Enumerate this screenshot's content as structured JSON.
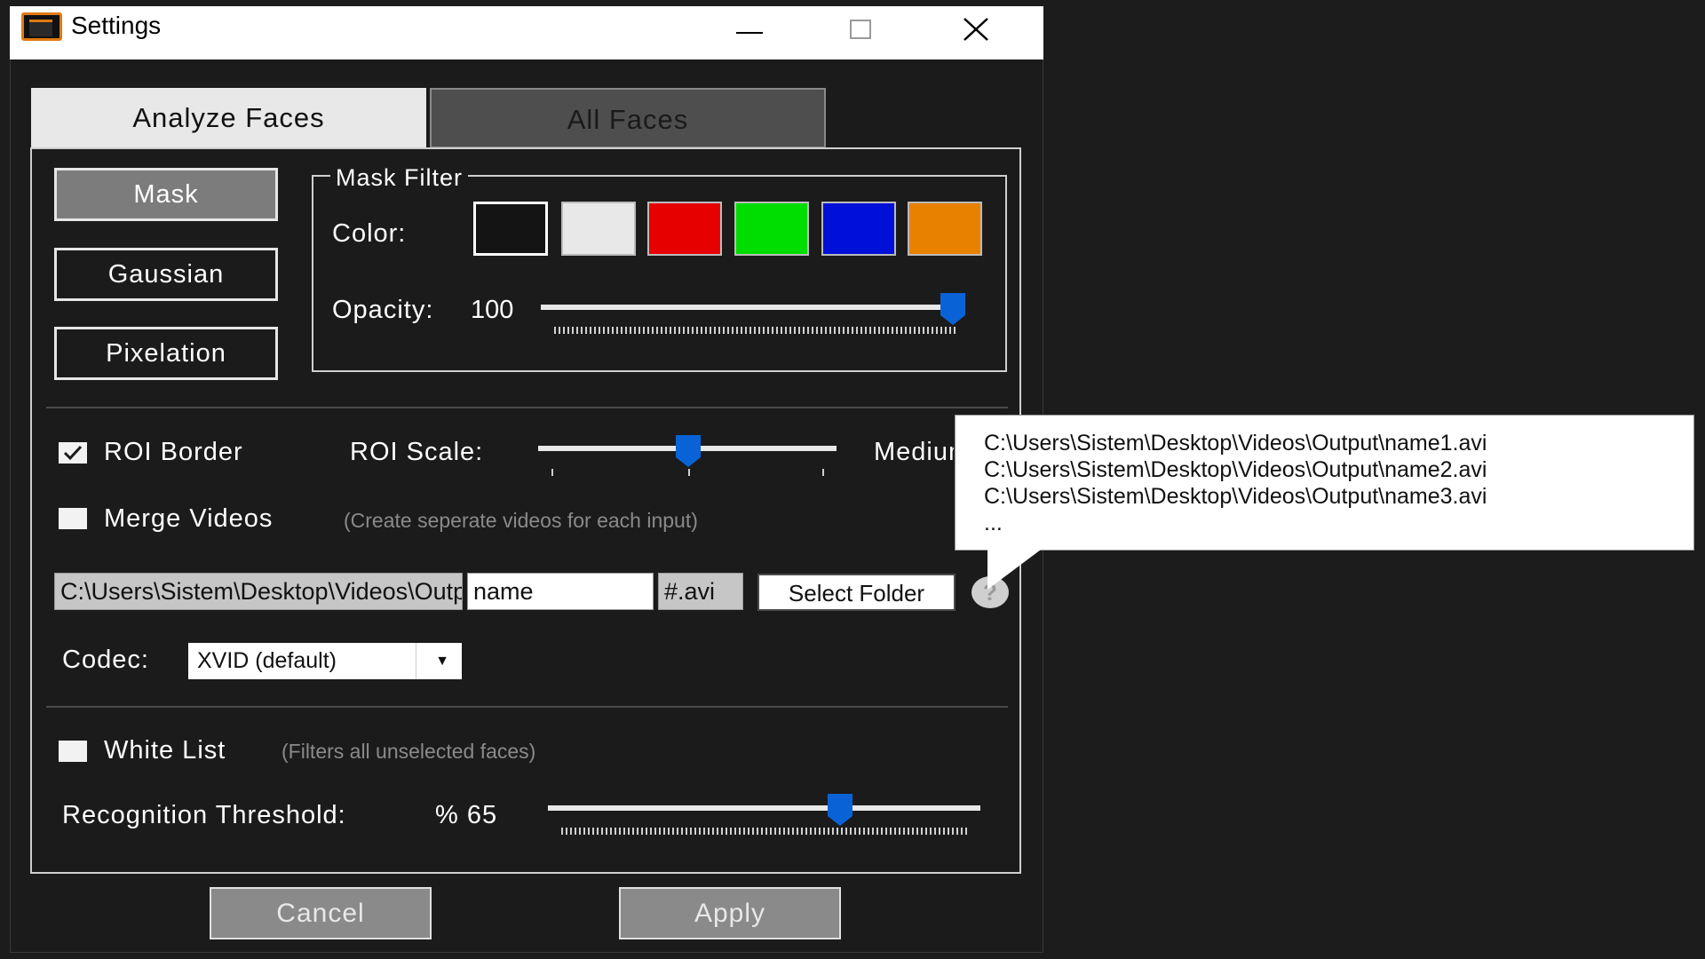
{
  "window": {
    "title": "Settings"
  },
  "tabs": [
    {
      "label": "Analyze Faces",
      "active": true
    },
    {
      "label": "All Faces",
      "active": false
    }
  ],
  "filter_buttons": [
    {
      "label": "Mask",
      "selected": true
    },
    {
      "label": "Gaussian",
      "selected": false
    },
    {
      "label": "Pixelation",
      "selected": false
    }
  ],
  "mask_filter": {
    "legend": "Mask Filter",
    "color_label": "Color:",
    "colors": [
      "#141414",
      "#e8e8e8",
      "#e60000",
      "#00dd00",
      "#0010d8",
      "#e88000"
    ],
    "selected_color": "#141414",
    "opacity_label": "Opacity:",
    "opacity_value": "100",
    "opacity_level": 100
  },
  "roi": {
    "border_label": "ROI Border",
    "border_checked": true,
    "scale_label": "ROI Scale:",
    "scale_value": "Medium",
    "scale_level": 0.5
  },
  "merge": {
    "label": "Merge Videos",
    "checked": false,
    "hint": "(Create seperate videos for each input)"
  },
  "output": {
    "folder": "C:\\Users\\Sistem\\Desktop\\Videos\\Output",
    "name": "name",
    "ext": "#.avi",
    "select_folder_label": "Select Folder",
    "help": "?"
  },
  "codec": {
    "label": "Codec:",
    "value": "XVID (default)"
  },
  "white_list": {
    "label": "White List",
    "checked": false,
    "hint": "(Filters all unselected faces)"
  },
  "recognition": {
    "label": "Recognition Threshold:",
    "value": "% 65",
    "level": 65
  },
  "actions": {
    "cancel": "Cancel",
    "apply": "Apply"
  },
  "tooltip": {
    "lines": [
      "C:\\Users\\Sistem\\Desktop\\Videos\\Output\\name1.avi",
      "C:\\Users\\Sistem\\Desktop\\Videos\\Output\\name2.avi",
      "C:\\Users\\Sistem\\Desktop\\Videos\\Output\\name3.avi",
      "..."
    ]
  },
  "colors": {
    "accent": "#0a63d6",
    "background": "#1b1b1b"
  }
}
